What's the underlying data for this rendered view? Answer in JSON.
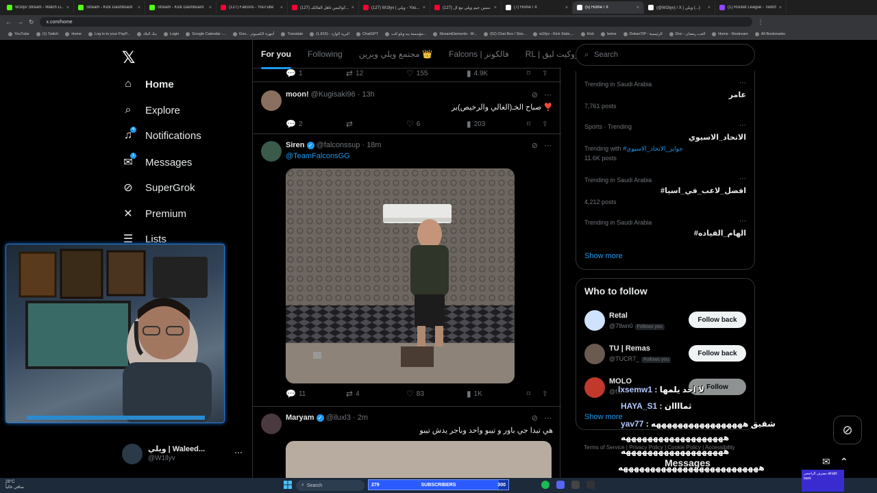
{
  "browser": {
    "tabs": [
      {
        "title": "W1llyv Stream - Watch Li...",
        "color": "#53fc18"
      },
      {
        "title": "Stream - Kick Dashboard",
        "color": "#53fc18"
      },
      {
        "title": "Stream - Kick Dashboard",
        "color": "#53fc18"
      },
      {
        "title": "(127) Falcons - YouTube",
        "color": "#ff0033"
      },
      {
        "title": "(127) كواليس تأهل الفالكنـ...",
        "color": "#ff0033"
      },
      {
        "title": "(127) W1llyv | ويلي - You...",
        "color": "#ff0033"
      },
      {
        "title": "(127) سبين جيم ويلي مع ال...",
        "color": "#ff0033"
      },
      {
        "title": "(7) Home / X",
        "color": "#ffffff"
      },
      {
        "title": "(5) Home / X",
        "color": "#ffffff",
        "active": true
      },
      {
        "title": "(@W1llyv) / X | ويلي (...)",
        "color": "#ffffff"
      },
      {
        "title": "(1) Rocket League - Twitch",
        "color": "#9146ff"
      }
    ],
    "url": "x.com/home",
    "bookmarks": [
      "YouTube",
      "(1) Twitch",
      "Home",
      "Log in to your PayP...",
      "بنك البلاد",
      "Login",
      "Google Calendar -...",
      "Goo... أجهزة الكمبيوتر",
      "Translate",
      "البريد الوارد - (1,815)",
      "ChatGPT",
      "مؤسسة بيه ويلو للت...",
      "StreamElements - M...",
      "(52) Chat Box / Stre...",
      "w1llyv - Kick Stats,...",
      "Kick",
      "botns",
      "DokanTIP - الرئيسية",
      "Doc - الغب رمضان",
      "Home - Restream",
      "All Bookmarks"
    ]
  },
  "nav": {
    "items": [
      {
        "label": "Home",
        "icon": "home-icon",
        "glyph": "⌂"
      },
      {
        "label": "Explore",
        "icon": "search-icon",
        "glyph": "⌕"
      },
      {
        "label": "Notifications",
        "icon": "bell-icon",
        "glyph": "🔔"
      },
      {
        "label": "Messages",
        "icon": "mail-icon",
        "glyph": "✉"
      },
      {
        "label": "SuperGrok",
        "icon": "grok-icon",
        "glyph": "⊘"
      },
      {
        "label": "Premium",
        "icon": "x-premium-icon",
        "glyph": "𝕏"
      },
      {
        "label": "Lists",
        "icon": "list-icon",
        "glyph": "☰"
      }
    ],
    "notifications_badge": "4",
    "messages_badge": "1",
    "account": {
      "name": "ويلي | Waleed...",
      "handle": "@W1llyv"
    }
  },
  "feed": {
    "tabs": [
      "For you",
      "Following",
      "مجتمع ويلي وبرين 👑",
      "Falcons | فالكونز",
      "RL | روكيت ليق"
    ],
    "top_post_stats": {
      "replies": "1",
      "reposts": "12",
      "likes": "155",
      "views": "4.9K"
    },
    "posts": [
      {
        "name": "moon!",
        "handle": "@Kugisaki96",
        "time": "· 13h",
        "text": "صباح الخـ(الغالي والرخيص)ير ❣️",
        "replies": "2",
        "reposts": "",
        "likes": "6",
        "views": "203",
        "avatar": "#8a6f5f"
      },
      {
        "name": "Siren",
        "handle": "@falconssup",
        "time": "· 18m",
        "text": "@TeamFalconsGG",
        "replies": "11",
        "reposts": "4",
        "likes": "83",
        "views": "1K",
        "avatar": "#3a5a4a",
        "verified": true
      },
      {
        "name": "Maryam",
        "handle": "@iluxl3",
        "time": "· 2m",
        "text": "هي تبدا جي باور و تيبو واحد وباجر يدش تيبو",
        "avatar": "#4a3a40",
        "verified": true
      }
    ]
  },
  "sidebar": {
    "search_placeholder": "Search",
    "trends": [
      {
        "context": "Trending in Saudi Arabia",
        "name": "عامر",
        "count": "7,761 posts"
      },
      {
        "context": "Sports · Trending",
        "name": "الاتحاد_الاسيوي",
        "with_label": "Trending with",
        "with": "#جوايز_الاتحاد_الاسيوي",
        "count": "11.6K posts"
      },
      {
        "context": "Trending in Saudi Arabia",
        "name": "#افضل_لاعب_في_اسيا",
        "count": "4,212 posts"
      },
      {
        "context": "Trending in Saudi Arabia",
        "name": "#الهام_القياده",
        "count": ""
      }
    ],
    "show_more": "Show more",
    "who_to_follow": {
      "title": "Who to follow",
      "users": [
        {
          "name": "Retal",
          "handle": "@7llwn0",
          "follows_you": "Follows you",
          "button": "Follow back",
          "avatar": "#cfe3ff"
        },
        {
          "name": "TU | Remas",
          "handle": "@TUCR7_",
          "follows_you": "Follows you",
          "button": "Follow back",
          "avatar": "#6b5a50"
        },
        {
          "name": "MOLO",
          "handle": "@f...",
          "follows_you": "",
          "button": "Follow",
          "avatar": "#c0392b"
        }
      ],
      "show_more": "Show more"
    },
    "footer": "Terms of Service | Privacy Policy | Cookie Policy | Accessibility"
  },
  "chat_overlay": [
    {
      "user": "lxsemw1",
      "msg": "لا احد يلمها"
    },
    {
      "user": "HAYA_S1",
      "msg": "ثماااان"
    },
    {
      "user": "yav77",
      "msg": "شقيق هههههههههههههههههه"
    },
    {
      "user": "",
      "msg": "هههههههههههههههههههه"
    },
    {
      "user": "",
      "msg": "هههههههههههههههههههه"
    },
    {
      "user": "",
      "msg": "ههههههههههههههههههههههههههه"
    }
  ],
  "messages_dock": "Messages",
  "taskbar": {
    "weather_temp": "28°C",
    "weather_desc": "صافي غالباً",
    "search": "Search",
    "subs_current": "279",
    "subs_label": "SUBSCRIBERS",
    "subs_goal": "300",
    "subs_progress": 0.93,
    "bank_text": "مصرف الراجحي alrajhi bank"
  },
  "colors": {
    "accent": "#1d9bf0",
    "bg": "#000000",
    "border": "#2f3336",
    "muted": "#71767b"
  }
}
